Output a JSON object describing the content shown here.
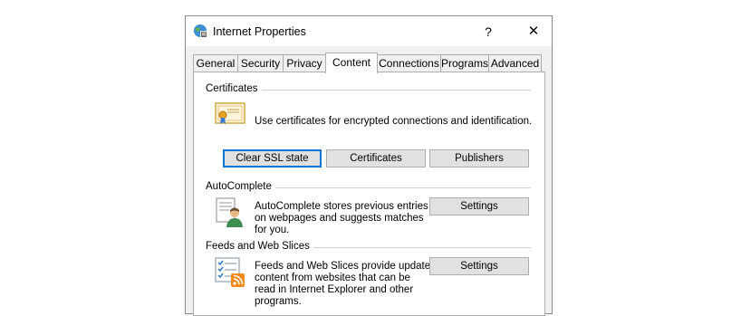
{
  "window": {
    "title": "Internet Properties",
    "help_label": "?",
    "close_label": "✕"
  },
  "tabs": [
    {
      "label": "General"
    },
    {
      "label": "Security"
    },
    {
      "label": "Privacy"
    },
    {
      "label": "Content",
      "active": true
    },
    {
      "label": "Connections"
    },
    {
      "label": "Programs"
    },
    {
      "label": "Advanced"
    }
  ],
  "certificates": {
    "heading": "Certificates",
    "description": "Use certificates for encrypted connections and identification.",
    "clear_ssl_label": "Clear SSL state",
    "certificates_label": "Certificates",
    "publishers_label": "Publishers"
  },
  "autocomplete": {
    "heading": "AutoComplete",
    "description_lines": [
      "AutoComplete stores previous entries",
      "on webpages and suggests matches",
      "for you."
    ],
    "settings_label": "Settings"
  },
  "feeds": {
    "heading": "Feeds and Web Slices",
    "description_lines": [
      "Feeds and Web Slices provide updated",
      "content from websites that can be",
      "read in Internet Explorer and other",
      "programs."
    ],
    "settings_label": "Settings"
  },
  "colors": {
    "focus": "#0078d7",
    "button_face": "#e1e1e1",
    "rss_orange": "#f28a1e"
  }
}
